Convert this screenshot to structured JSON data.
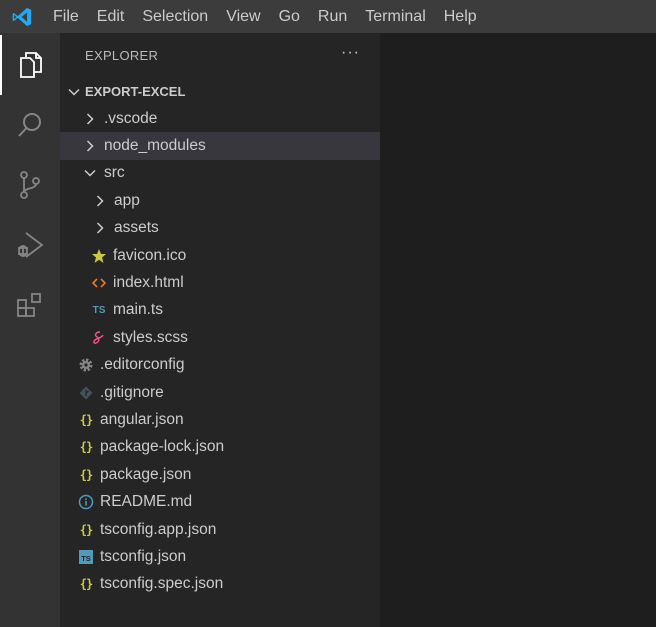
{
  "menu": [
    "File",
    "Edit",
    "Selection",
    "View",
    "Go",
    "Run",
    "Terminal",
    "Help"
  ],
  "activity": [
    {
      "name": "explorer-icon",
      "active": true
    },
    {
      "name": "search-icon",
      "active": false
    },
    {
      "name": "source-control-icon",
      "active": false
    },
    {
      "name": "run-debug-icon",
      "active": false
    },
    {
      "name": "extensions-icon",
      "active": false
    }
  ],
  "explorer": {
    "title": "EXPLORER",
    "more": "···",
    "section_title": "EXPORT-EXCEL",
    "tree": [
      {
        "label": ".vscode",
        "type": "folder",
        "expanded": false,
        "depth": 0
      },
      {
        "label": "node_modules",
        "type": "folder",
        "expanded": false,
        "depth": 0,
        "selected": true
      },
      {
        "label": "src",
        "type": "folder",
        "expanded": true,
        "depth": 0
      },
      {
        "label": "app",
        "type": "folder",
        "expanded": false,
        "depth": 1
      },
      {
        "label": "assets",
        "type": "folder",
        "expanded": false,
        "depth": 1
      },
      {
        "label": "favicon.ico",
        "type": "file",
        "icon": "star-icon",
        "depth": 1
      },
      {
        "label": "index.html",
        "type": "file",
        "icon": "html-icon",
        "depth": 1
      },
      {
        "label": "main.ts",
        "type": "file",
        "icon": "typescript-icon",
        "depth": 1
      },
      {
        "label": "styles.scss",
        "type": "file",
        "icon": "sass-icon",
        "depth": 1
      },
      {
        "label": ".editorconfig",
        "type": "file",
        "icon": "gear-icon",
        "depth": 0
      },
      {
        "label": ".gitignore",
        "type": "file",
        "icon": "git-icon",
        "depth": 0
      },
      {
        "label": "angular.json",
        "type": "file",
        "icon": "json-icon",
        "depth": 0
      },
      {
        "label": "package-lock.json",
        "type": "file",
        "icon": "json-icon",
        "depth": 0
      },
      {
        "label": "package.json",
        "type": "file",
        "icon": "json-icon",
        "depth": 0
      },
      {
        "label": "README.md",
        "type": "file",
        "icon": "info-icon",
        "depth": 0
      },
      {
        "label": "tsconfig.app.json",
        "type": "file",
        "icon": "json-icon",
        "depth": 0
      },
      {
        "label": "tsconfig.json",
        "type": "file",
        "icon": "ts-box-icon",
        "depth": 0
      },
      {
        "label": "tsconfig.spec.json",
        "type": "file",
        "icon": "json-icon",
        "depth": 0
      }
    ]
  },
  "icon_text": {
    "ts": "TS",
    "json": "{}"
  },
  "colors": {
    "menubar": "#3c3c3c",
    "activitybar": "#333333",
    "sidebar": "#252526",
    "editor": "#1e1e1e",
    "selected_row": "#37373d",
    "vscode_blue": "#23a9f2",
    "json_yellow": "#cbcb41",
    "ts_blue": "#519aba",
    "html_orange": "#e37933",
    "sass_pink": "#f55385"
  }
}
